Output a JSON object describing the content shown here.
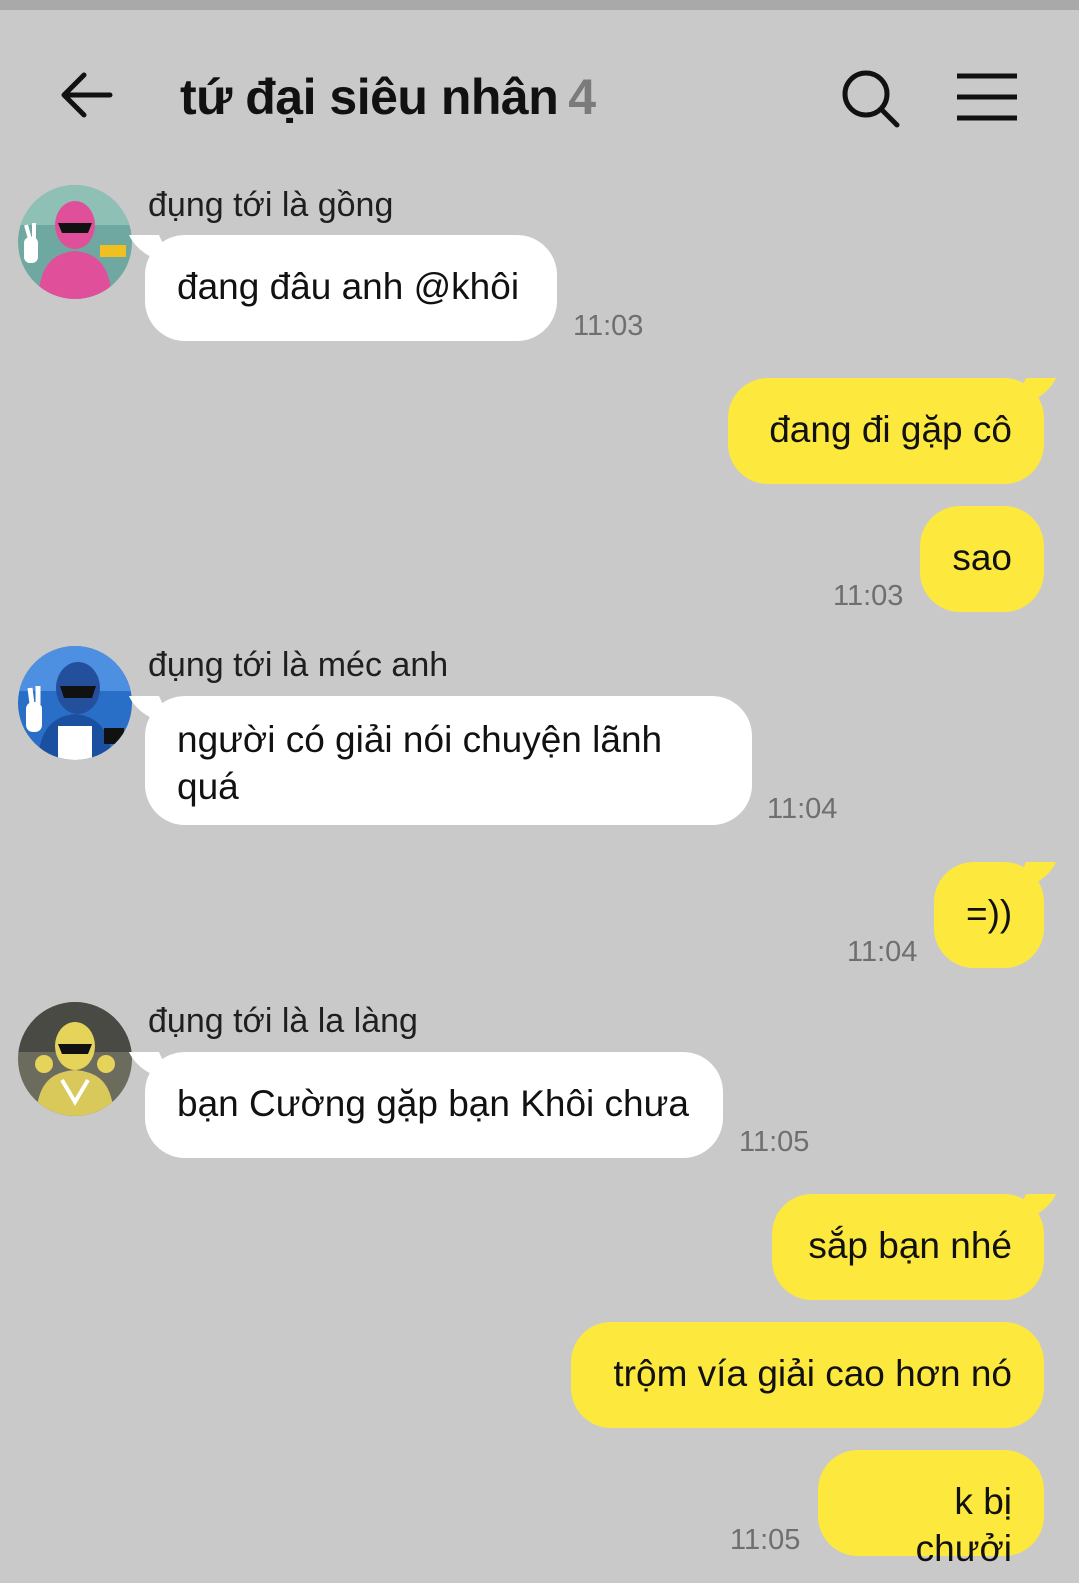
{
  "header": {
    "title": "tứ đại siêu nhân",
    "member_count": "4",
    "back_icon": "arrow-left-icon",
    "search_icon": "search-icon",
    "menu_icon": "hamburger-menu-icon"
  },
  "colors": {
    "background": "#c9c9c9",
    "incoming_bubble": "#ffffff",
    "outgoing_bubble": "#fde93e",
    "timestamp": "#6f6f6f"
  },
  "messages": [
    {
      "sender": "đụng tới là gồng",
      "text": "đang đâu anh @khôi",
      "time": "11:03"
    },
    {
      "text": "đang đi gặp cô"
    },
    {
      "text": "sao",
      "time": "11:03"
    },
    {
      "sender": "đụng tới là méc anh",
      "text": "người có giải nói chuyện lãnh quá",
      "time": "11:04"
    },
    {
      "text": "=))",
      "time": "11:04"
    },
    {
      "sender": "đụng tới là la làng",
      "text": "bạn Cường gặp bạn Khôi chưa",
      "time": "11:05"
    },
    {
      "text": "sắp bạn nhé"
    },
    {
      "text": "trộm vía giải cao hơn nó"
    },
    {
      "text": "k bị chưởi",
      "time": "11:05"
    }
  ]
}
